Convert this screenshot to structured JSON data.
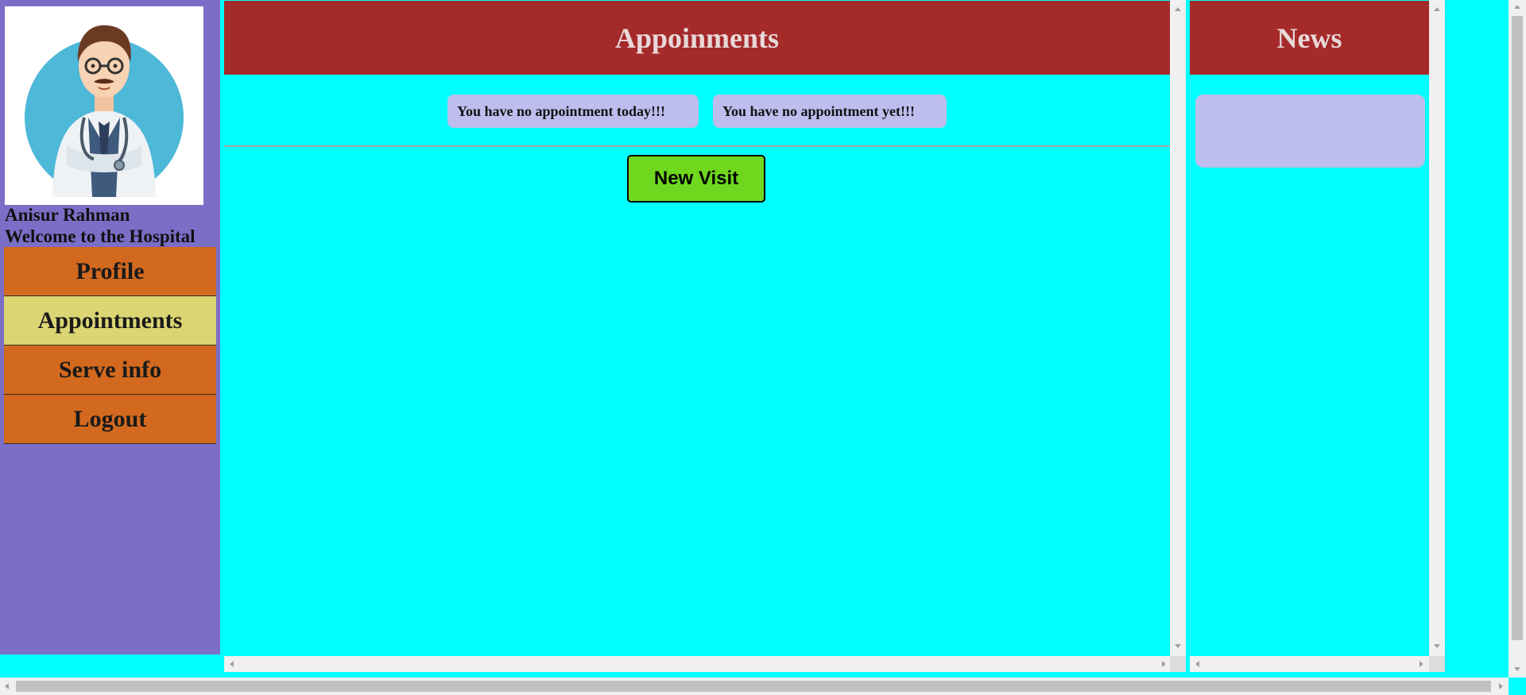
{
  "sidebar": {
    "avatar_alt": "doctor-avatar",
    "user_name": "Anisur Rahman",
    "welcome": "Welcome to the Hospital",
    "nav": [
      {
        "label": "Profile",
        "active": false
      },
      {
        "label": "Appointments",
        "active": true
      },
      {
        "label": "Serve info",
        "active": false
      },
      {
        "label": "Logout",
        "active": false
      }
    ]
  },
  "main": {
    "title": "Appoinments",
    "notice_today": "You have no appointment today!!!",
    "notice_yet": "You have no appointment yet!!!",
    "new_visit_label": "New Visit"
  },
  "news": {
    "title": "News"
  },
  "colors": {
    "background": "#00ffff",
    "sidebar": "#7b6ec6",
    "header": "#a52a2a",
    "nav_item": "#d2691e",
    "nav_active": "#dcd573",
    "notice": "#bdbdee",
    "button": "#6fd81e"
  }
}
